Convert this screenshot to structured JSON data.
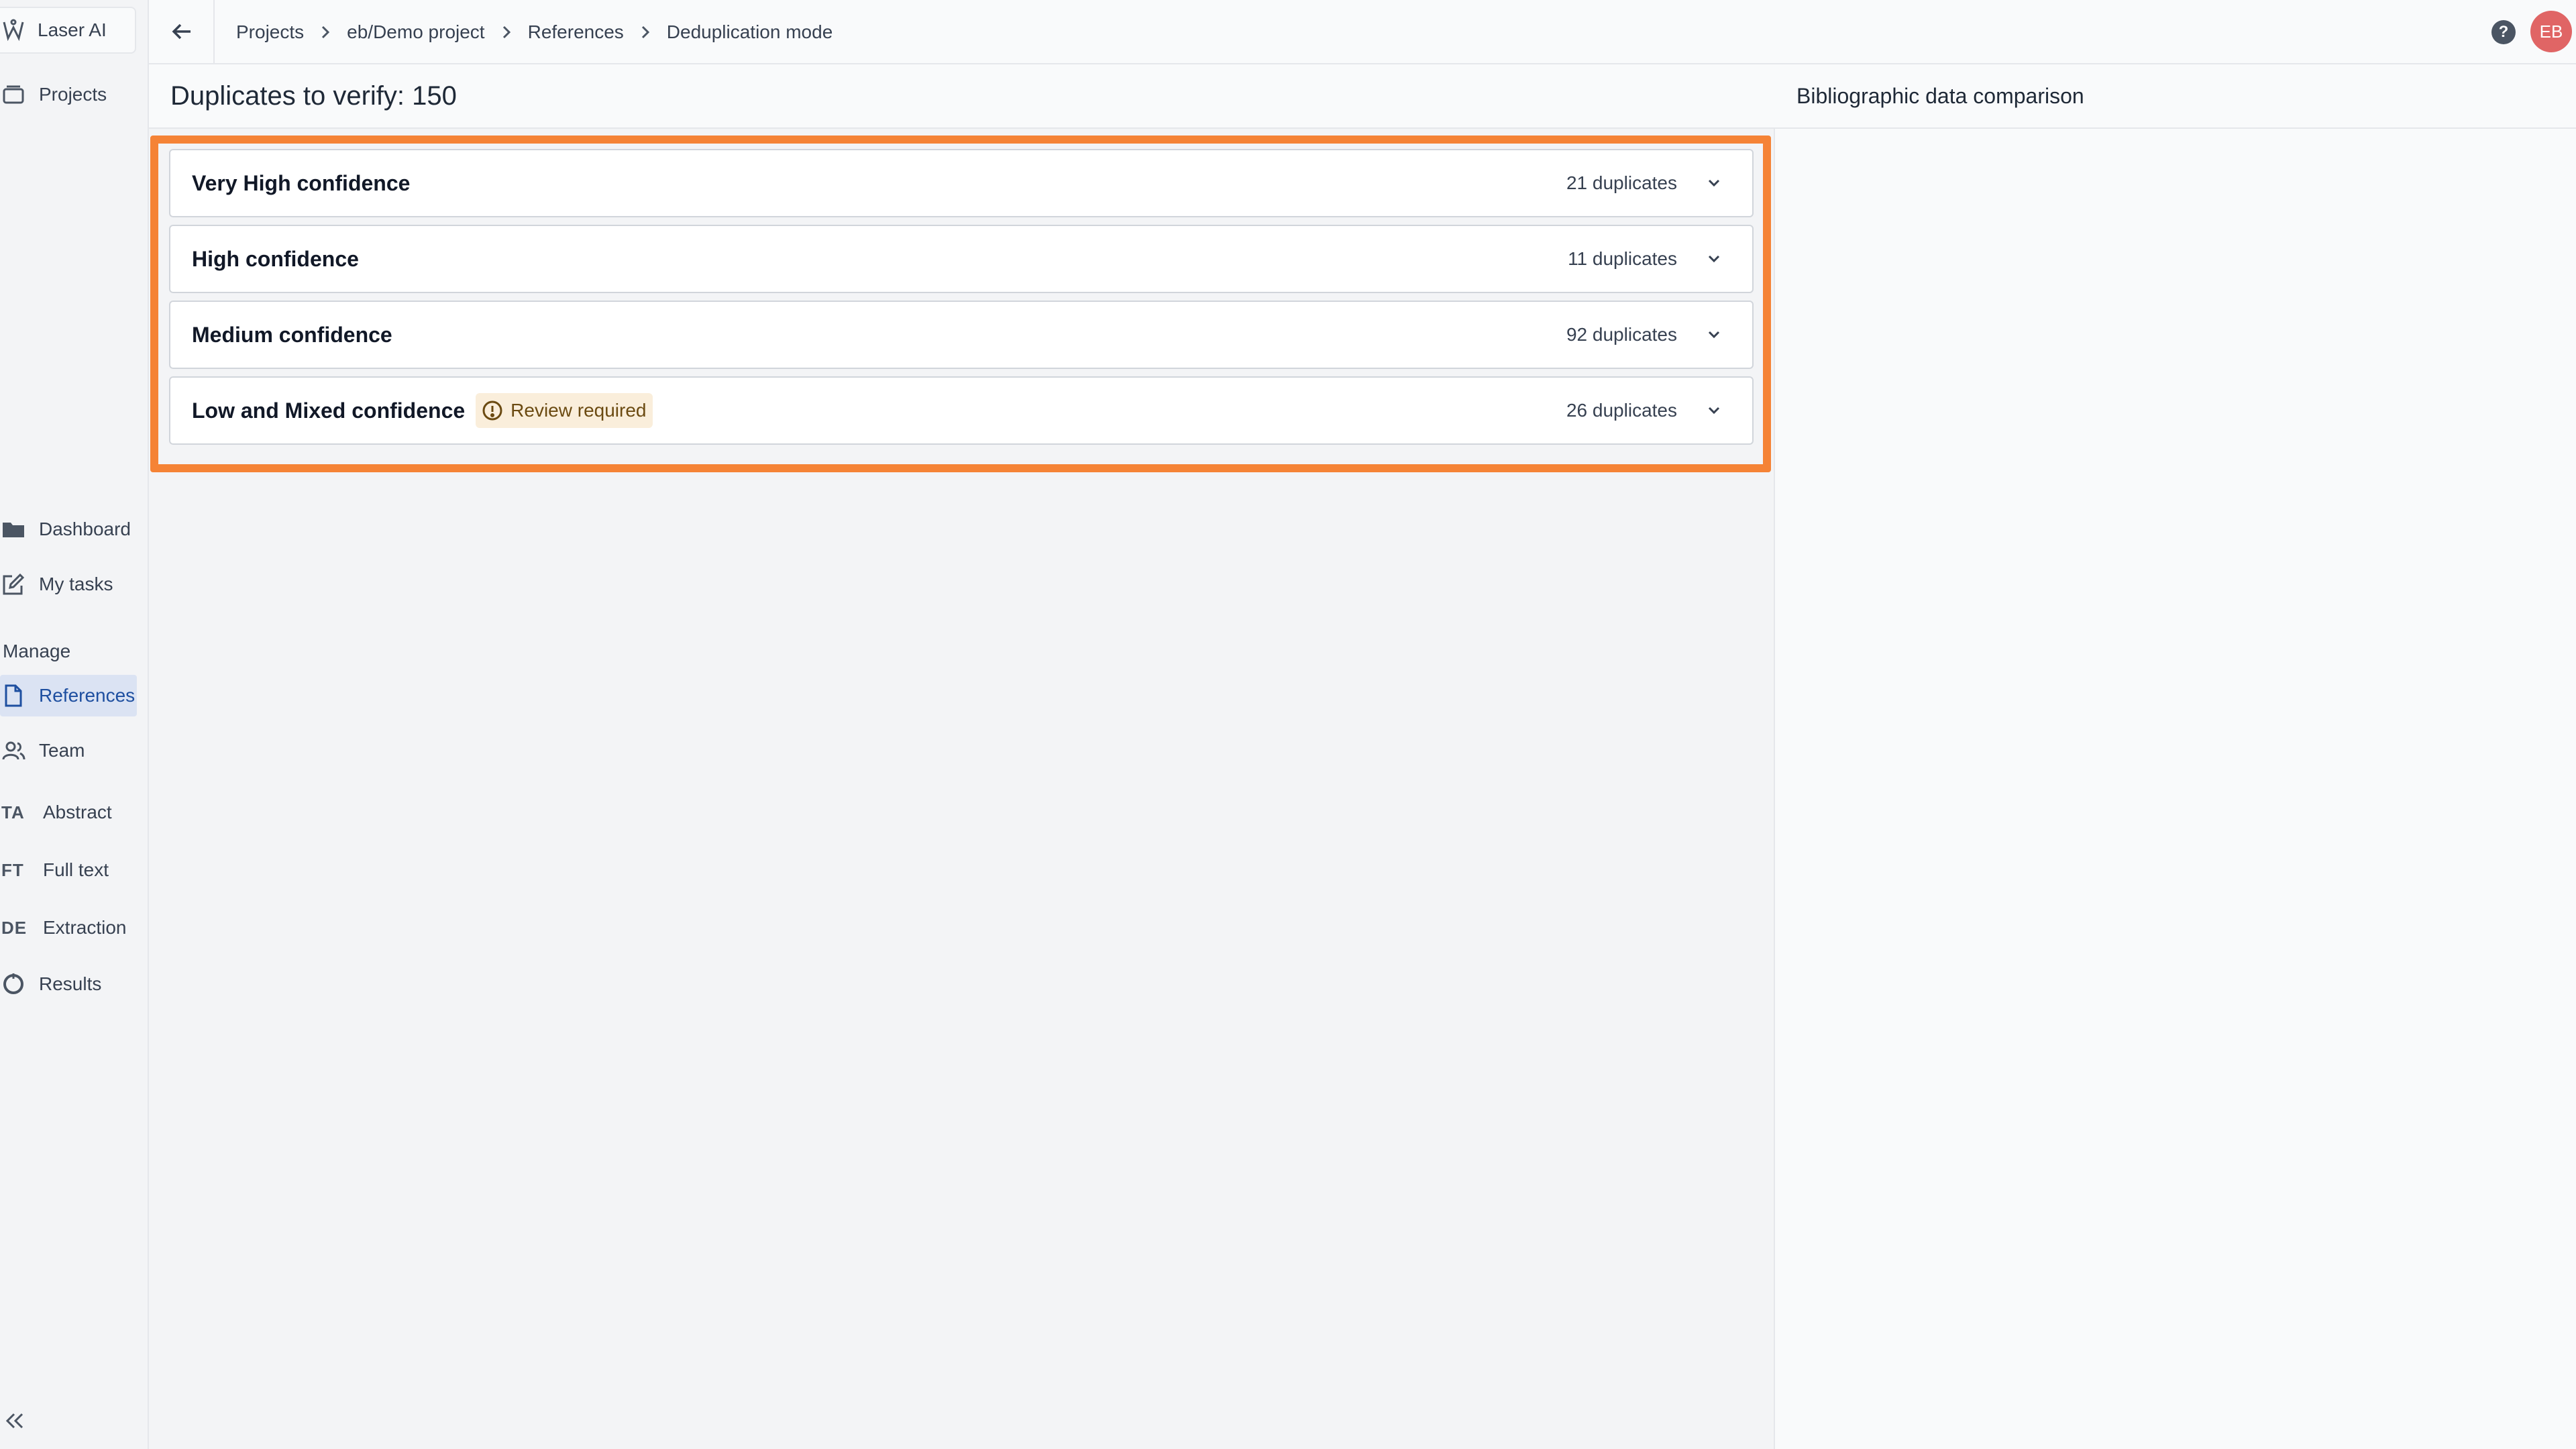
{
  "app": {
    "brand": "Laser AI"
  },
  "sidebar": {
    "projects_label": "Projects",
    "items_top": [
      {
        "label": "Dashboard",
        "icon": "folder-icon"
      },
      {
        "label": "My tasks",
        "icon": "edit-icon"
      }
    ],
    "section_label": "Manage",
    "items_manage": [
      {
        "label": "References",
        "icon": "document-icon",
        "active": true
      },
      {
        "label": "Team",
        "icon": "users-icon"
      },
      {
        "label": "Abstract",
        "abbr": "TA"
      },
      {
        "label": "Full text",
        "abbr": "FT"
      },
      {
        "label": "Extraction",
        "abbr": "DE"
      },
      {
        "label": "Results",
        "icon": "chart-pie-icon"
      }
    ]
  },
  "breadcrumb": [
    "Projects",
    "eb/Demo project",
    "References",
    "Deduplication mode"
  ],
  "user": {
    "initials": "EB"
  },
  "main": {
    "title": "Duplicates to verify: 150",
    "groups": [
      {
        "title": "Very High confidence",
        "count": "21 duplicates"
      },
      {
        "title": "High confidence",
        "count": "11 duplicates"
      },
      {
        "title": "Medium confidence",
        "count": "92 duplicates"
      },
      {
        "title": "Low and Mixed confidence",
        "badge": "Review required",
        "count": "26 duplicates"
      }
    ]
  },
  "right_panel": {
    "title": "Bibliographic data comparison"
  },
  "colors": {
    "accent": "#f58336",
    "active_nav": "#1e4fa0",
    "avatar": "#e06565",
    "badge_bg": "#faeedb"
  }
}
